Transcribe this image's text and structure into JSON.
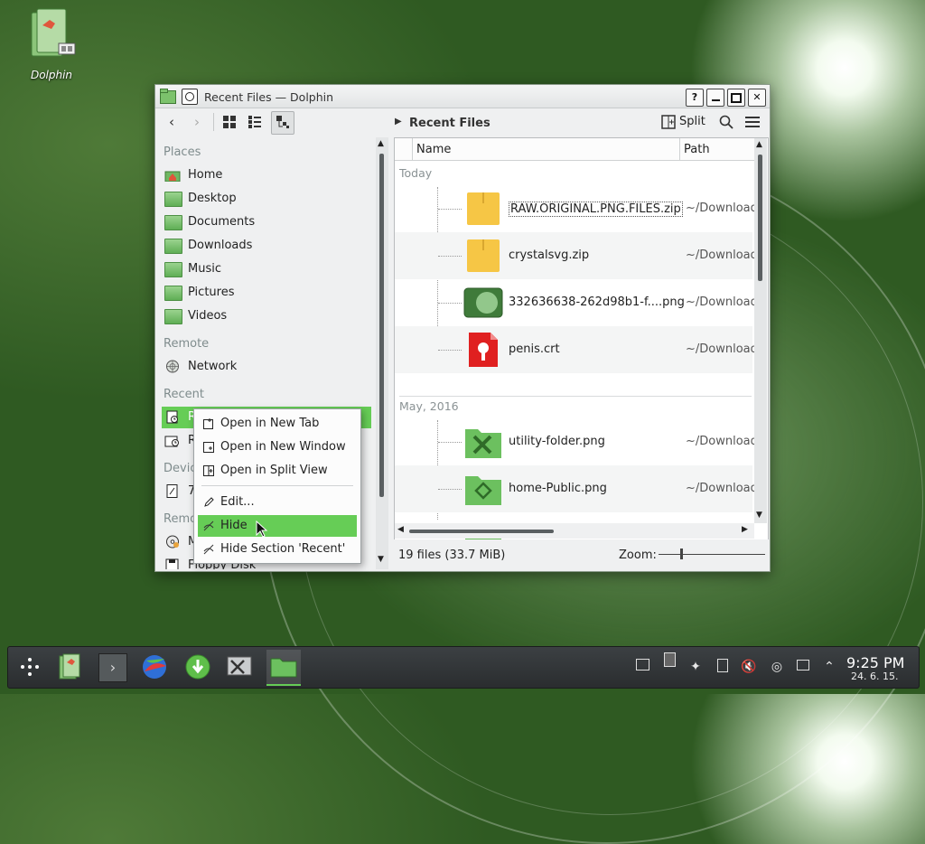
{
  "desktop": {
    "icon_label": "Dolphin"
  },
  "window": {
    "title": "Recent Files — Dolphin",
    "buttons": {
      "help": "?",
      "minimize": "–",
      "maximize": "□",
      "close": "✕"
    }
  },
  "toolbar": {
    "breadcrumb": "Recent Files",
    "split_label": "Split"
  },
  "places": {
    "sections": {
      "places": "Places",
      "remote": "Remote",
      "recent": "Recent",
      "devices": "Devic",
      "removable": "Remo"
    },
    "items": [
      {
        "label": "Home"
      },
      {
        "label": "Desktop"
      },
      {
        "label": "Documents"
      },
      {
        "label": "Downloads"
      },
      {
        "label": "Music"
      },
      {
        "label": "Pictures"
      },
      {
        "label": "Videos"
      },
      {
        "label": "Network"
      },
      {
        "label": "Re"
      },
      {
        "label": "Re"
      },
      {
        "label": "70"
      },
      {
        "label": "M"
      },
      {
        "label": "Floppy Disk"
      }
    ]
  },
  "fileview": {
    "columns": {
      "name": "Name",
      "path": "Path"
    },
    "groups": [
      {
        "label": "Today",
        "files": [
          {
            "name": "RAW.ORIGINAL.PNG.FILES.zip",
            "path": "~/Download",
            "icon": "zip-archive-icon"
          },
          {
            "name": "crystalsvg.zip",
            "path": "~/Download",
            "icon": "zip-archive-icon"
          },
          {
            "name": "332636638-262d98b1-f....png",
            "path": "~/Download",
            "icon": "image-icon"
          },
          {
            "name": "penis.crt",
            "path": "~/Download",
            "icon": "certificate-icon"
          }
        ]
      },
      {
        "label": "May, 2016",
        "files": [
          {
            "name": "utility-folder.png",
            "path": "~/Download",
            "icon": "utility-folder-icon"
          },
          {
            "name": "home-Public.png",
            "path": "~/Download",
            "icon": "public-folder-icon"
          }
        ]
      }
    ]
  },
  "statusbar": {
    "summary": "19 files (33.7 MiB)",
    "zoom_label": "Zoom:"
  },
  "context_menu": {
    "items": [
      {
        "label": "Open in New Tab"
      },
      {
        "label": "Open in New Window"
      },
      {
        "label": "Open in Split View"
      },
      {
        "label": "Edit..."
      },
      {
        "label": "Hide"
      },
      {
        "label": "Hide Section 'Recent'"
      }
    ]
  },
  "taskbar": {
    "time": "9:25 PM",
    "date": "24. 6. 15."
  },
  "colors": {
    "accent": "#66cd56",
    "window_bg": "#eff0f1",
    "taskbar_bg": "#2f3234"
  }
}
